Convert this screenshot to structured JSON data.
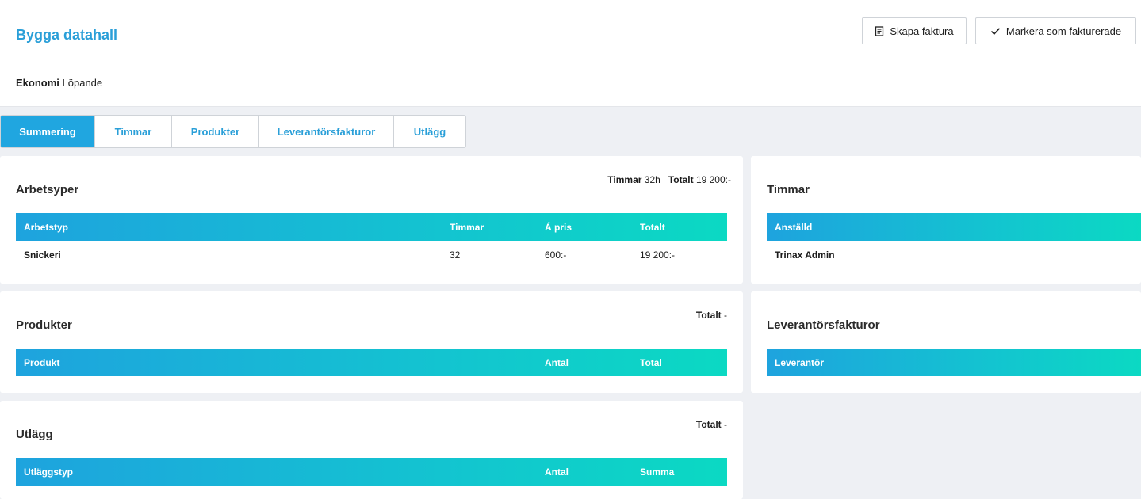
{
  "header": {
    "title": "Bygga datahall",
    "economy_label": "Ekonomi",
    "economy_value": "Löpande",
    "create_invoice_label": "Skapa faktura",
    "mark_invoiced_label": "Markera som fakturerade"
  },
  "tabs": [
    {
      "label": "Summering",
      "active": true
    },
    {
      "label": "Timmar"
    },
    {
      "label": "Produkter"
    },
    {
      "label": "Leverantörsfakturor"
    },
    {
      "label": "Utlägg"
    }
  ],
  "worktypes": {
    "title": "Arbetsyper",
    "summary_hours_label": "Timmar",
    "summary_hours_value": "32h",
    "summary_total_label": "Totalt",
    "summary_total_value": "19 200:-",
    "columns": [
      "Arbetstyp",
      "Timmar",
      "Á pris",
      "Totalt"
    ],
    "rows": [
      [
        "Snickeri",
        "32",
        "600:-",
        "19 200:-"
      ]
    ]
  },
  "hours": {
    "title": "Timmar",
    "columns": [
      "Anställd"
    ],
    "rows": [
      [
        "Trinax Admin"
      ]
    ]
  },
  "products": {
    "title": "Produkter",
    "summary_total_label": "Totalt",
    "summary_total_value": "-",
    "columns": [
      "Produkt",
      "Antal",
      "Total"
    ]
  },
  "supplier_invoices": {
    "title": "Leverantörsfakturor",
    "columns": [
      "Leverantör"
    ]
  },
  "expenses": {
    "title": "Utlägg",
    "summary_total_label": "Totalt",
    "summary_total_value": "-",
    "columns": [
      "Utläggstyp",
      "Antal",
      "Summa"
    ]
  },
  "colors": {
    "accent": "#20a6e0",
    "gradient_start": "#1ea3de",
    "gradient_end": "#0bd9c3",
    "title_blue": "#2a9fd8"
  },
  "icons": {
    "create_invoice": "invoice-icon",
    "mark_invoiced": "check-icon"
  }
}
